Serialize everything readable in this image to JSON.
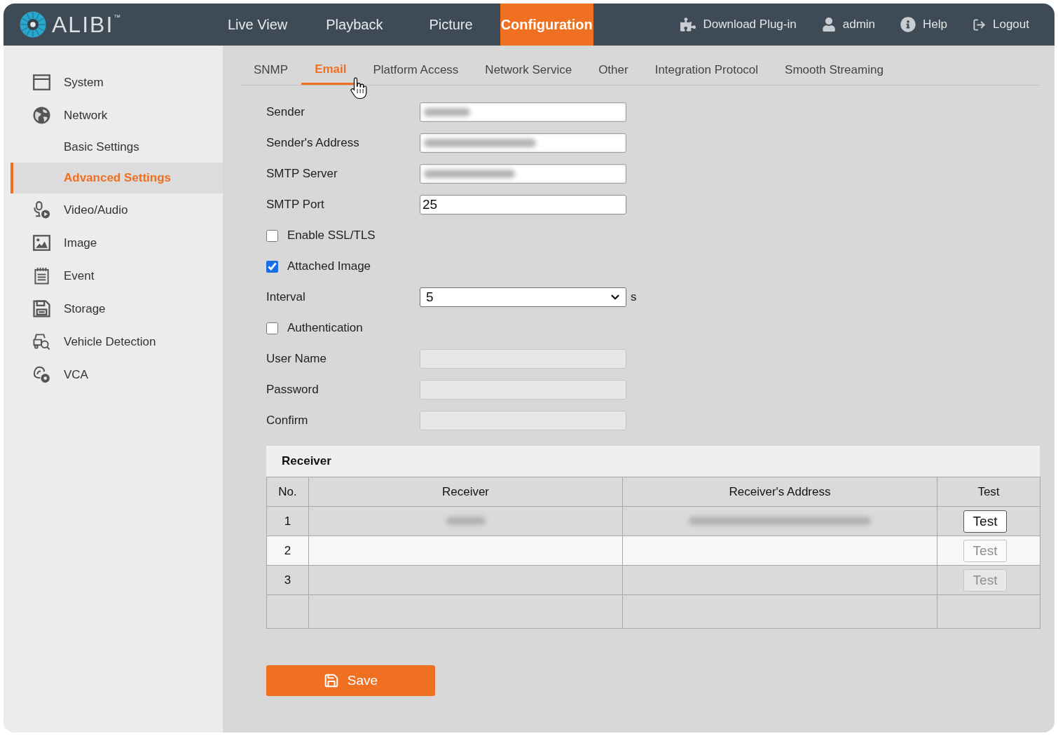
{
  "logo": {
    "text": "ALIBI$^{™}$"
  },
  "nav": {
    "items": [
      {
        "label": "Live View",
        "selected": false
      },
      {
        "label": "Playback",
        "selected": false
      },
      {
        "label": "Picture",
        "selected": false
      },
      {
        "label": "Configuration",
        "selected": true
      }
    ],
    "actions": [
      {
        "label": "Download Plug-in"
      },
      {
        "label": "admin"
      },
      {
        "label": "Help"
      },
      {
        "label": "Logout"
      }
    ]
  },
  "sidebar": {
    "items": [
      {
        "label": "System",
        "selected": false
      },
      {
        "label": "Network",
        "selected": false,
        "children": [
          {
            "label": "Basic Settings",
            "selected": false
          },
          {
            "label": "Advanced Settings",
            "selected": true
          }
        ]
      },
      {
        "label": "Video/Audio",
        "selected": false
      },
      {
        "label": "Image",
        "selected": false
      },
      {
        "label": "Event",
        "selected": false
      },
      {
        "label": "Storage",
        "selected": false
      },
      {
        "label": "Vehicle Detection",
        "selected": false
      },
      {
        "label": "VCA",
        "selected": false
      }
    ]
  },
  "tabs": [
    {
      "label": "SNMP",
      "selected": false
    },
    {
      "label": "Email",
      "selected": true
    },
    {
      "label": "Platform Access",
      "selected": false
    },
    {
      "label": "Network Service",
      "selected": false
    },
    {
      "label": "Other",
      "selected": false
    },
    {
      "label": "Integration Protocol",
      "selected": false
    },
    {
      "label": "Smooth Streaming",
      "selected": false
    }
  ],
  "form": {
    "fields": [
      {
        "kind": "text",
        "label": "Sender",
        "redacted": true,
        "disabled": false
      },
      {
        "kind": "text",
        "label": "Sender's Address",
        "redacted": true,
        "disabled": false
      },
      {
        "kind": "text",
        "label": "SMTP Server",
        "redacted": true,
        "disabled": false
      },
      {
        "kind": "text",
        "label": "SMTP Port",
        "value": "25",
        "redacted": false,
        "disabled": false
      },
      {
        "kind": "checkbox",
        "label": "Enable SSL/TLS",
        "checked": false
      },
      {
        "kind": "checkbox",
        "label": "Attached Image",
        "checked": true
      },
      {
        "kind": "select",
        "label": "Interval",
        "value": "5",
        "unit": "s"
      },
      {
        "kind": "checkbox",
        "label": "Authentication",
        "checked": false
      },
      {
        "kind": "text",
        "label": "User Name",
        "redacted": false,
        "disabled": true
      },
      {
        "kind": "text",
        "label": "Password",
        "redacted": false,
        "disabled": true
      },
      {
        "kind": "text",
        "label": "Confirm",
        "redacted": false,
        "disabled": true
      }
    ]
  },
  "receiver": {
    "title": "Receiver",
    "table": {
      "columns": [
        "No.",
        "Receiver",
        "Receiver's Address",
        "Test"
      ],
      "rows": [
        {
          "no": "1",
          "receiver_redacted": true,
          "address_redacted": true,
          "test": {
            "label": "Test",
            "disabled": false
          }
        },
        {
          "no": "2",
          "receiver_redacted": false,
          "address_redacted": false,
          "test": {
            "label": "Test",
            "disabled": true
          }
        },
        {
          "no": "3",
          "receiver_redacted": false,
          "address_redacted": false,
          "test": {
            "label": "Test",
            "disabled": true
          }
        }
      ]
    }
  },
  "save_button": {
    "label": "Save"
  }
}
